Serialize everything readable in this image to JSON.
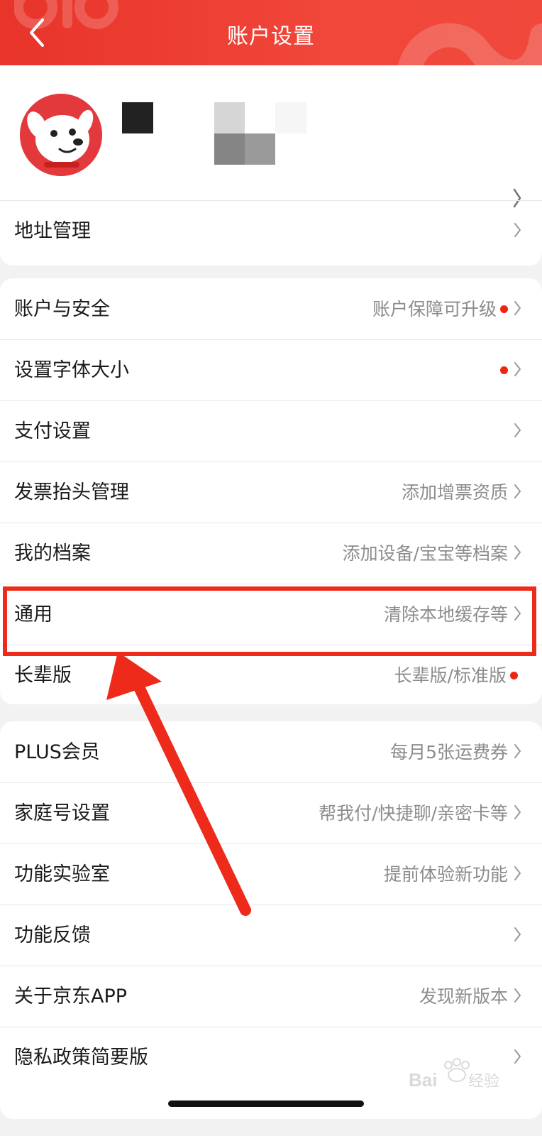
{
  "header": {
    "title": "账户设置"
  },
  "sections": [
    {
      "id": "address",
      "rows": [
        {
          "label": "地址管理",
          "value": "",
          "dot": false,
          "chevron": true
        }
      ]
    },
    {
      "id": "account",
      "rows": [
        {
          "label": "账户与安全",
          "value": "账户保障可升级",
          "dot": true,
          "chevron": true
        },
        {
          "label": "设置字体大小",
          "value": "",
          "dot": true,
          "chevron": true
        },
        {
          "label": "支付设置",
          "value": "",
          "dot": false,
          "chevron": true
        },
        {
          "label": "发票抬头管理",
          "value": "添加增票资质",
          "dot": false,
          "chevron": true
        },
        {
          "label": "我的档案",
          "value": "添加设备/宝宝等档案",
          "dot": false,
          "chevron": true
        },
        {
          "label": "通用",
          "value": "清除本地缓存等",
          "dot": false,
          "chevron": true,
          "highlighted": true
        },
        {
          "label": "长辈版",
          "value": "长辈版/标准版",
          "dot": true,
          "chevron": false
        }
      ]
    },
    {
      "id": "more",
      "rows": [
        {
          "label": "PLUS会员",
          "value": "每月5张运费券",
          "dot": false,
          "chevron": true
        },
        {
          "label": "家庭号设置",
          "value": "帮我付/快捷聊/亲密卡等",
          "dot": false,
          "chevron": true
        },
        {
          "label": "功能实验室",
          "value": "提前体验新功能",
          "dot": false,
          "chevron": true
        },
        {
          "label": "功能反馈",
          "value": "",
          "dot": false,
          "chevron": true
        },
        {
          "label": "关于京东APP",
          "value": "发现新版本",
          "dot": false,
          "chevron": true
        },
        {
          "label": "隐私政策简要版",
          "value": "",
          "dot": false,
          "chevron": true
        }
      ]
    }
  ],
  "icons": {
    "back": "chevron-left-icon",
    "row_arrow": "chevron-right-icon",
    "dot": "red-dot-icon",
    "avatar": "jd-dog-mascot-icon"
  },
  "colors": {
    "header": "#ee3a2f",
    "accent": "#f0250f",
    "annotation": "#ee2a1b",
    "background": "#f2f2f2",
    "card": "#ffffff",
    "secondary_text": "#8c8c8c"
  },
  "watermark": "Bai经验"
}
